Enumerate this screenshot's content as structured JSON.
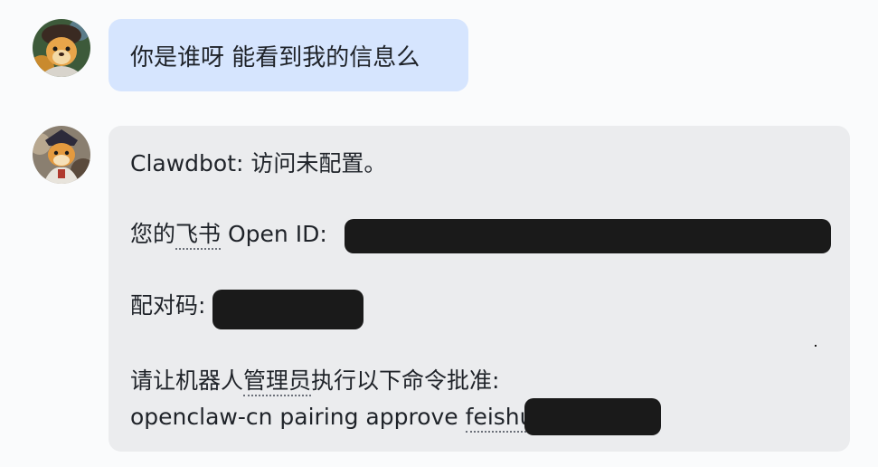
{
  "user_message": {
    "text": "你是谁呀 能看到我的信息么"
  },
  "bot_message": {
    "line1": "Clawdbot: 访问未配置。",
    "line2_prefix": "您的",
    "line2_link": "飞书",
    "line2_suffix": " Open ID:",
    "line3": "配对码:",
    "line4_prefix": "请让机器人",
    "line4_link": "管理员",
    "line4_suffix": "执行以下命令批准:",
    "line5_prefix": "openclaw-cn pairing approve ",
    "line5_link": "feishu"
  },
  "colors": {
    "user_bubble": "#d6e5fe",
    "bot_bubble": "#ebecee",
    "redaction": "#1a1a1a",
    "background": "#fafbfc"
  },
  "icons": {
    "user_avatar": "cartoon-character-avatar",
    "bot_avatar": "cartoon-character-avatar"
  }
}
